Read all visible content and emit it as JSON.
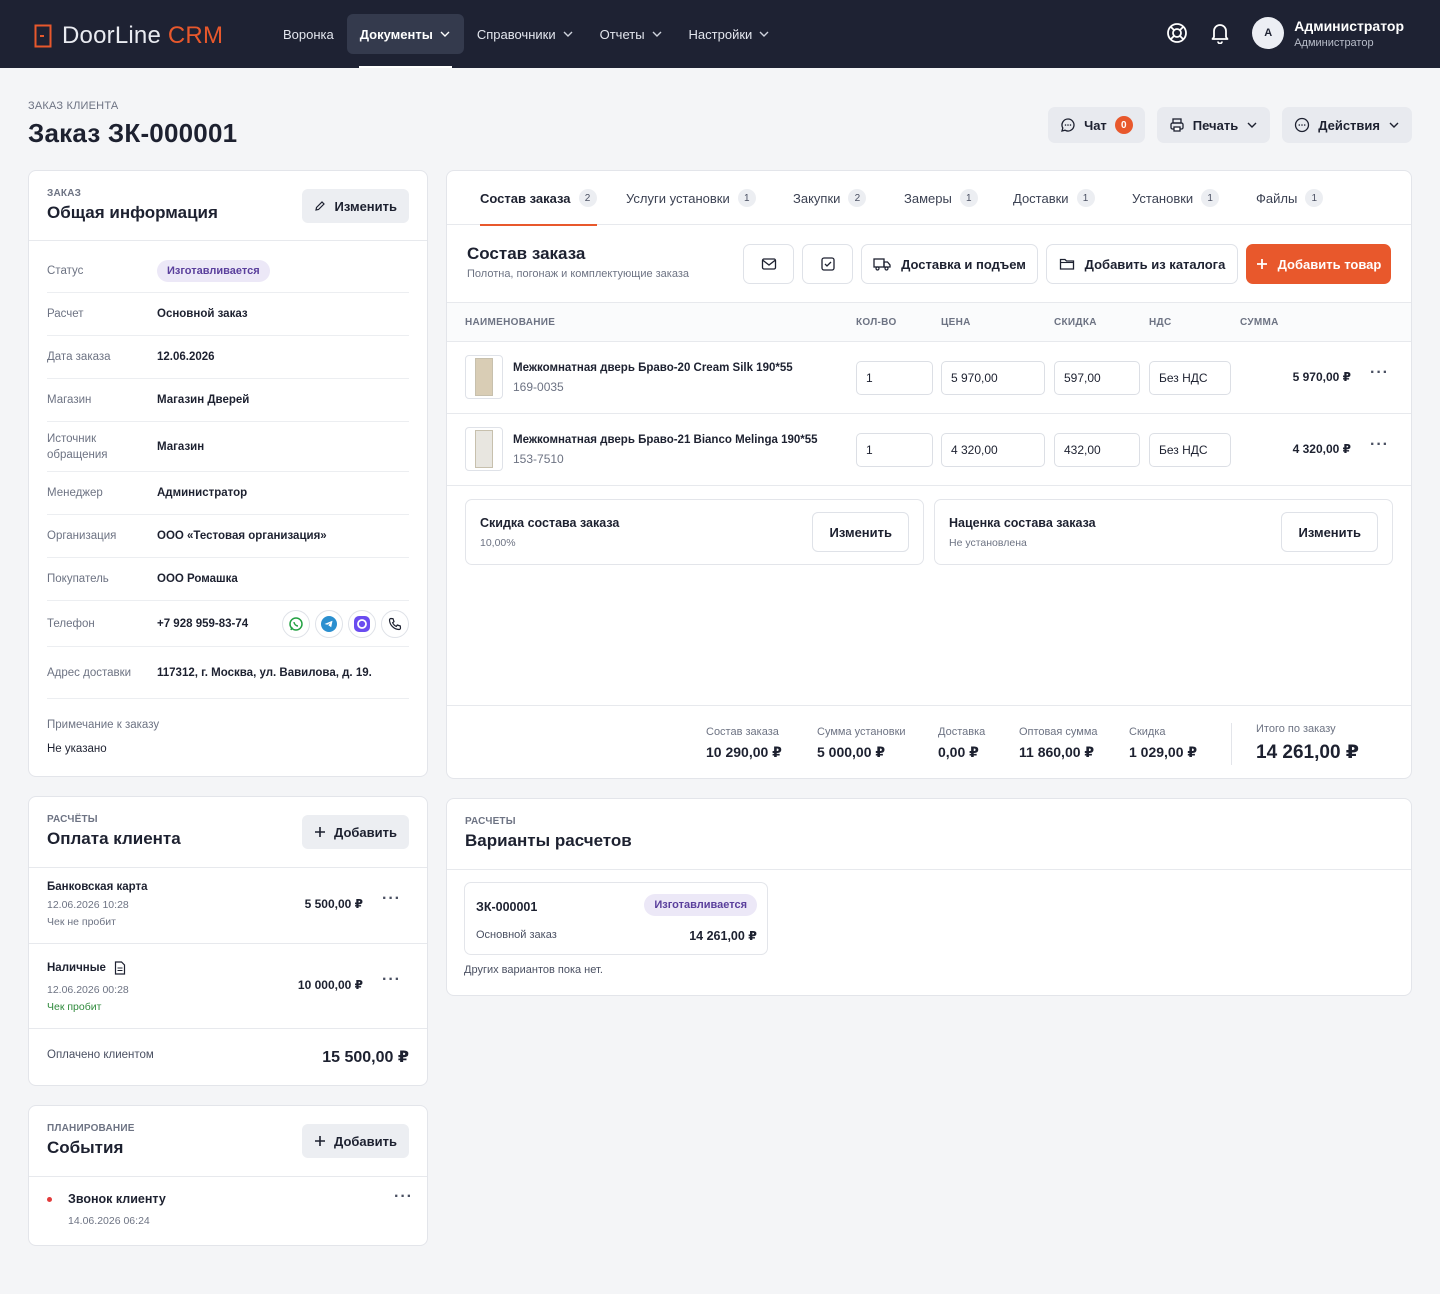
{
  "header": {
    "logo_main": "DoorLine",
    "logo_accent": "CRM",
    "nav": [
      {
        "label": "Воронка",
        "active": false,
        "dropdown": false
      },
      {
        "label": "Документы",
        "active": true,
        "dropdown": true
      },
      {
        "label": "Справочники",
        "active": false,
        "dropdown": true
      },
      {
        "label": "Отчеты",
        "active": false,
        "dropdown": true
      },
      {
        "label": "Настройки",
        "active": false,
        "dropdown": true
      }
    ],
    "user": {
      "initial": "A",
      "name": "Администратор",
      "role": "Администратор"
    }
  },
  "page": {
    "eyebrow": "ЗАКАЗ КЛИЕНТА",
    "title": "Заказ ЗК-000001",
    "actions": {
      "chat": "Чат",
      "chat_count": "0",
      "print": "Печать",
      "actions": "Действия"
    }
  },
  "order_info": {
    "eyebrow": "ЗАКАЗ",
    "title": "Общая информация",
    "edit": "Изменить",
    "rows": [
      {
        "label": "Статус",
        "value": "Изготавливается"
      },
      {
        "label": "Расчет",
        "value": "Основной заказ"
      },
      {
        "label": "Дата заказа",
        "value": "12.06.2026"
      },
      {
        "label": "Магазин",
        "value": "Магазин Дверей"
      },
      {
        "label": "Источник обращения",
        "value": "Магазин"
      },
      {
        "label": "Менеджер",
        "value": "Администратор"
      },
      {
        "label": "Организация",
        "value": "ООО «Тестовая организация»"
      },
      {
        "label": "Покупатель",
        "value": "ООО Ромашка"
      },
      {
        "label": "Телефон",
        "value": "+7 928 959-83-74"
      },
      {
        "label": "Адрес доставки",
        "value": "117312, г. Москва, ул. Вавилова, д. 19."
      }
    ],
    "note_label": "Примечание к заказу",
    "note_value": "Не указано"
  },
  "payments": {
    "eyebrow": "РАСЧЁТЫ",
    "title": "Оплата клиента",
    "add": "Добавить",
    "items": [
      {
        "method": "Банковская карта",
        "date": "12.06.2026 10:28",
        "check": "Чек не пробит",
        "amount": "5 500,00 ₽"
      },
      {
        "method": "Наличные",
        "date": "12.06.2026 00:28",
        "check": "Чек пробит",
        "amount": "10 000,00 ₽"
      }
    ],
    "paid_label": "Оплачено клиентом",
    "paid_value": "15 500,00 ₽"
  },
  "events": {
    "eyebrow": "ПЛАНИРОВАНИЕ",
    "title": "События",
    "add": "Добавить",
    "items": [
      {
        "title": "Звонок клиенту",
        "date": "14.06.2026 06:24"
      }
    ]
  },
  "composition": {
    "tabs": [
      {
        "label": "Состав заказа",
        "count": "2"
      },
      {
        "label": "Услуги установки",
        "count": "1"
      },
      {
        "label": "Закупки",
        "count": "2"
      },
      {
        "label": "Замеры",
        "count": "1"
      },
      {
        "label": "Доставки",
        "count": "1"
      },
      {
        "label": "Установки",
        "count": "1"
      },
      {
        "label": "Файлы",
        "count": "1"
      }
    ],
    "title": "Состав заказа",
    "subtitle": "Полотна, погонаж и комплектующие заказа",
    "btn_delivery": "Доставка и подъем",
    "btn_catalog": "Добавить из каталога",
    "btn_add": "Добавить товар",
    "columns": {
      "name": "НАИМЕНОВАНИЕ",
      "qty": "КОЛ-ВО",
      "price": "ЦЕНА",
      "discount": "СКИДКА",
      "vat": "НДС",
      "sum": "СУММА"
    },
    "items": [
      {
        "name": "Межкомнатная дверь Браво-20 Cream Silk 190*55",
        "sku": "169-0035",
        "qty": "1",
        "price": "5 970,00",
        "discount": "597,00",
        "vat": "Без НДС",
        "sum": "5 970,00 ₽"
      },
      {
        "name": "Межкомнатная дверь Браво-21 Bianco Melinga 190*55",
        "sku": "153-7510",
        "qty": "1",
        "price": "4 320,00",
        "discount": "432,00",
        "vat": "Без НДС",
        "sum": "4 320,00 ₽"
      }
    ],
    "discount_box": {
      "title": "Скидка состава заказа",
      "value": "10,00%",
      "button": "Изменить"
    },
    "markup_box": {
      "title": "Наценка состава заказа",
      "value": "Не установлена",
      "button": "Изменить"
    },
    "totals": [
      {
        "label": "Состав заказа",
        "value": "10 290,00 ₽"
      },
      {
        "label": "Сумма установки",
        "value": "5 000,00 ₽"
      },
      {
        "label": "Доставка",
        "value": "0,00 ₽"
      },
      {
        "label": "Оптовая сумма",
        "value": "11 860,00 ₽"
      },
      {
        "label": "Скидка",
        "value": "1 029,00 ₽"
      }
    ],
    "grand_label": "Итого по заказу",
    "grand_value": "14 261,00 ₽"
  },
  "variants": {
    "eyebrow": "РАСЧЕТЫ",
    "title": "Варианты расчетов",
    "card": {
      "number": "ЗК-000001",
      "status": "Изготавливается",
      "name": "Основной заказ",
      "amount": "14 261,00 ₽"
    },
    "empty": "Других вариантов пока нет."
  },
  "colors": {
    "accent": "#e8582c",
    "topbar": "#1e2233",
    "status_purple": "#ece8f7",
    "success": "#2f8a3c",
    "dot_red": "#e23b3b"
  }
}
